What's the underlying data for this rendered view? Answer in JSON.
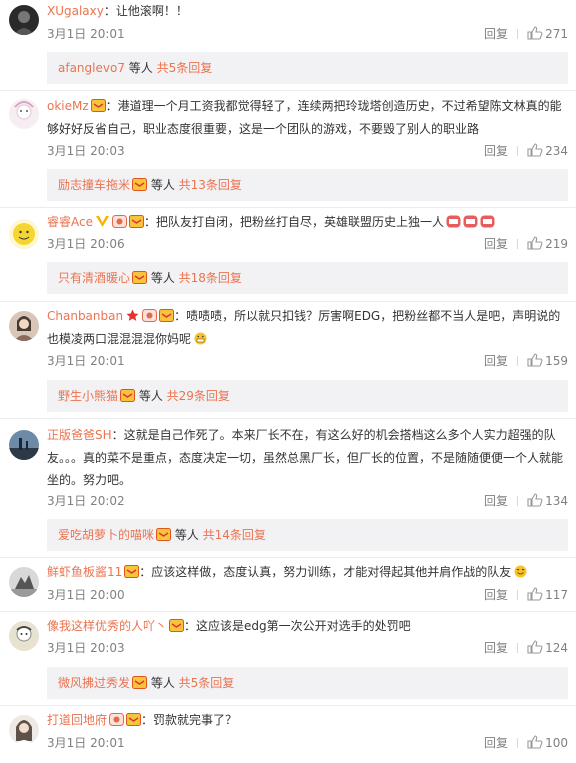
{
  "colors": {
    "link": "#eb7350",
    "meta": "#808080",
    "subbox_bg": "#f2f2f5"
  },
  "comments": [
    {
      "user": "XUgalaxy",
      "text": "：让他滚啊！！",
      "time": "3月1日 20:01",
      "reply": "回复",
      "likes": "271",
      "sub": {
        "user": "afanglevo7",
        "mid": " 等人 ",
        "more": "共5条回复"
      }
    },
    {
      "user": "okieMz",
      "text": "：港道理一个月工资我都觉得轻了，连续两把玲珑塔创造历史，不过希望陈文林真的能够好好反省自己，职业态度很重要，这是一个团队的游戏，不要毁了别人的职业路",
      "time": "3月1日 20:03",
      "reply": "回复",
      "likes": "234",
      "sub": {
        "user": "励志撞车拖米",
        "mid": " 等人 ",
        "more": "共13条回复"
      }
    },
    {
      "user": "睿睿Ace",
      "text": "：把队友打自闭，把粉丝打自尽，英雄联盟历史上独一人",
      "time": "3月1日 20:06",
      "reply": "回复",
      "likes": "219",
      "sub": {
        "user": "只有清酒暖心",
        "mid": " 等人 ",
        "more": "共18条回复"
      }
    },
    {
      "user": "Chanbanban",
      "text": "：啧啧啧，所以就只扣钱？厉害啊EDG，把粉丝都不当人是吧，声明说的也模凌两口混混混混你妈呢",
      "time": "3月1日 20:01",
      "reply": "回复",
      "likes": "159",
      "sub": {
        "user": "野生小熊猫",
        "mid": " 等人 ",
        "more": "共29条回复"
      }
    },
    {
      "user": "正版爸爸SH",
      "text": "：这就是自己作死了。本来厂长不在，有这么好的机会搭档这么多个人实力超强的队友。。。真的菜不是重点，态度决定一切，虽然总黑厂长，但厂长的位置，不是随随便便一个人就能坐的。努力吧。",
      "time": "3月1日 20:02",
      "reply": "回复",
      "likes": "134",
      "sub": {
        "user": "爱吃胡萝卜的喵咪",
        "mid": " 等人 ",
        "more": "共14条回复"
      }
    },
    {
      "user": "鲜虾鱼板酱11",
      "text": "：应该这样做，态度认真，努力训练，才能对得起其他并肩作战的队友",
      "time": "3月1日 20:00",
      "reply": "回复",
      "likes": "117"
    },
    {
      "user": "像我这样优秀的人吖丶",
      "text": "：这应该是edg第一次公开对选手的处罚吧",
      "time": "3月1日 20:03",
      "reply": "回复",
      "likes": "124",
      "sub": {
        "user": "微风拂过秀发",
        "mid": " 等人 ",
        "more": "共5条回复"
      }
    },
    {
      "user": "打道回地府",
      "text": "：罚款就完事了？",
      "time": "3月1日 20:01",
      "reply": "回复",
      "likes": "100"
    }
  ]
}
